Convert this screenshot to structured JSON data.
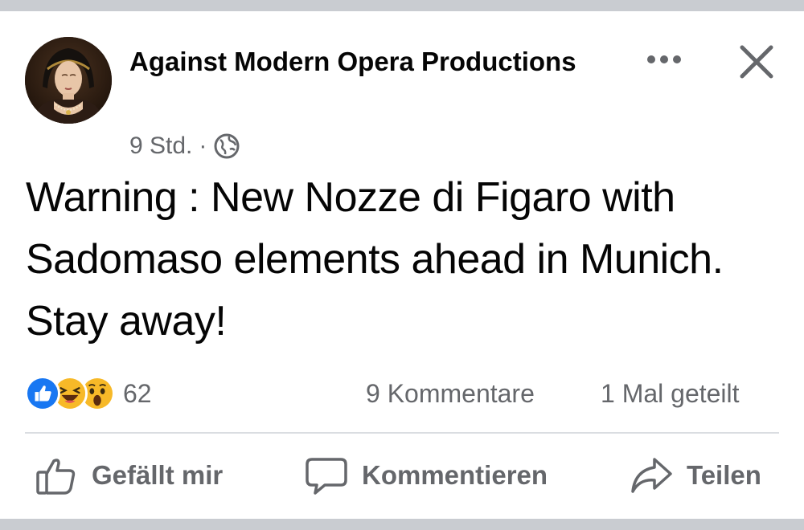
{
  "post": {
    "author": "Against Modern Opera Productions",
    "time": "9 Std.",
    "separator": "·",
    "audience_icon": "globe-icon",
    "text": "Warning : New Nozze di Figaro with Sadomaso elements ahead in Munich. Stay away!"
  },
  "reactions": {
    "icons": [
      "like-reaction-icon",
      "haha-reaction-icon",
      "wow-reaction-icon"
    ],
    "count": "62",
    "comments": "9 Kommentare",
    "shares": "1 Mal geteilt"
  },
  "actions": {
    "like": "Gefällt mir",
    "comment": "Kommentieren",
    "share": "Teilen"
  },
  "colors": {
    "like_blue": "#1877f2",
    "emoji_yellow": "#f7b928",
    "secondary_text": "#65676b",
    "divider": "#dadde1",
    "band": "#c9ccd1"
  }
}
